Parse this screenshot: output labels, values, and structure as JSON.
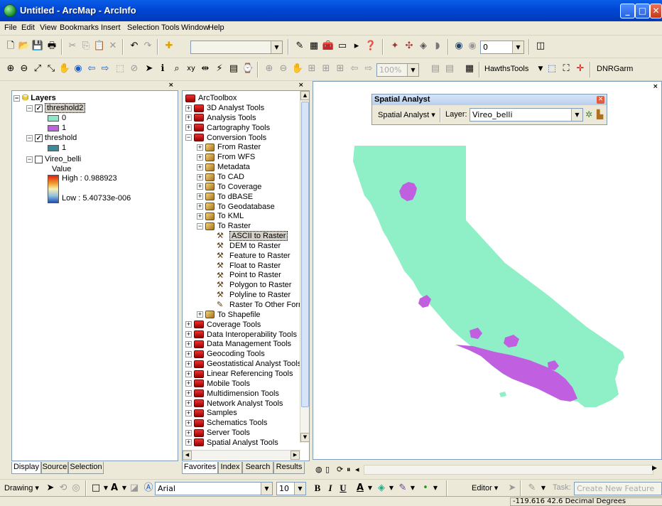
{
  "window": {
    "title": "Untitled - ArcMap - ArcInfo",
    "app_icon": "globe-icon",
    "minimize_glyph": "_",
    "maximize_glyph": "□",
    "close_glyph": "✕"
  },
  "menu": [
    "File",
    "Edit",
    "View",
    "Bookmarks",
    "Insert",
    "Selection",
    "Tools",
    "Window",
    "Help"
  ],
  "standard_toolbar": {
    "new": "🗋",
    "open": "📂",
    "save": "💾",
    "print": "🖶",
    "cut": "✂",
    "copy": "⎘",
    "paste": "📋",
    "delete": "✕",
    "undo": "↶",
    "redo": "↷",
    "add_data": "✚",
    "scale_value": "",
    "editor_toolbar_btn": "✎",
    "arc_catalog_btn": "▦",
    "toolbox_btn": "🧰",
    "cmd_line_btn": "▭",
    "python_btn": "▸",
    "whats_this": "❓",
    "effects_zoom": "0",
    "effects_btn": "◫"
  },
  "tools_toolbar": {
    "zoom_in": "⊕",
    "zoom_out": "⊖",
    "fixed_zoom_in": "⤢",
    "fixed_zoom_out": "⤡",
    "pan": "✋",
    "full_extent": "◉",
    "back": "⇦",
    "forward": "⇨",
    "select_features": "⬚",
    "clear_selection": "⊘",
    "select_elements": "➤",
    "identify": "ℹ",
    "find": "⌕",
    "go_to_xy": "xy",
    "measure": "⇹",
    "hyperlink": "⚡",
    "html_popup": "▤",
    "time_slider": "⌚",
    "zoom_pct": "100%",
    "hawths_label": "HawthsTools",
    "dnr_label": "DNRGarm"
  },
  "toc": {
    "root": "Layers",
    "layers": [
      {
        "name": "threshold2",
        "checked": true,
        "legend": [
          {
            "label": "0",
            "color": "#88E8C8"
          },
          {
            "label": "1",
            "color": "#C060E0"
          }
        ]
      },
      {
        "name": "threshold",
        "checked": true,
        "legend": [
          {
            "label": "1",
            "color": "#3A8A9A"
          }
        ]
      },
      {
        "name": "Vireo_belli",
        "checked": false,
        "value_label": "Value",
        "high": "High : 0.988923",
        "low": "Low : 5.40733e-006"
      }
    ],
    "tabs": [
      "Display",
      "Source",
      "Selection"
    ],
    "close": "×"
  },
  "toolbox": {
    "root": "ArcToolbox",
    "items": [
      {
        "label": "3D Analyst Tools",
        "level": 1,
        "kind": "toolbox",
        "exp": "+"
      },
      {
        "label": "Analysis Tools",
        "level": 1,
        "kind": "toolbox",
        "exp": "+"
      },
      {
        "label": "Cartography Tools",
        "level": 1,
        "kind": "toolbox",
        "exp": "+"
      },
      {
        "label": "Conversion Tools",
        "level": 1,
        "kind": "toolbox",
        "exp": "−"
      },
      {
        "label": "From Raster",
        "level": 2,
        "kind": "toolset",
        "exp": "+"
      },
      {
        "label": "From WFS",
        "level": 2,
        "kind": "toolset",
        "exp": "+"
      },
      {
        "label": "Metadata",
        "level": 2,
        "kind": "toolset",
        "exp": "+"
      },
      {
        "label": "To CAD",
        "level": 2,
        "kind": "toolset",
        "exp": "+"
      },
      {
        "label": "To Coverage",
        "level": 2,
        "kind": "toolset",
        "exp": "+"
      },
      {
        "label": "To dBASE",
        "level": 2,
        "kind": "toolset",
        "exp": "+"
      },
      {
        "label": "To Geodatabase",
        "level": 2,
        "kind": "toolset",
        "exp": "+"
      },
      {
        "label": "To KML",
        "level": 2,
        "kind": "toolset",
        "exp": "+"
      },
      {
        "label": "To Raster",
        "level": 2,
        "kind": "toolset",
        "exp": "−"
      },
      {
        "label": "ASCII to Raster",
        "level": 3,
        "kind": "tool",
        "exp": "",
        "selected": true
      },
      {
        "label": "DEM to Raster",
        "level": 3,
        "kind": "tool",
        "exp": ""
      },
      {
        "label": "Feature to Raster",
        "level": 3,
        "kind": "tool",
        "exp": ""
      },
      {
        "label": "Float to Raster",
        "level": 3,
        "kind": "tool",
        "exp": ""
      },
      {
        "label": "Point to Raster",
        "level": 3,
        "kind": "tool",
        "exp": ""
      },
      {
        "label": "Polygon to Raster",
        "level": 3,
        "kind": "tool",
        "exp": ""
      },
      {
        "label": "Polyline to Raster",
        "level": 3,
        "kind": "tool",
        "exp": ""
      },
      {
        "label": "Raster To Other Form",
        "level": 3,
        "kind": "script",
        "exp": ""
      },
      {
        "label": "To Shapefile",
        "level": 2,
        "kind": "toolset",
        "exp": "+"
      },
      {
        "label": "Coverage Tools",
        "level": 1,
        "kind": "toolbox",
        "exp": "+"
      },
      {
        "label": "Data Interoperability Tools",
        "level": 1,
        "kind": "toolbox",
        "exp": "+"
      },
      {
        "label": "Data Management Tools",
        "level": 1,
        "kind": "toolbox",
        "exp": "+"
      },
      {
        "label": "Geocoding Tools",
        "level": 1,
        "kind": "toolbox",
        "exp": "+"
      },
      {
        "label": "Geostatistical Analyst Tools",
        "level": 1,
        "kind": "toolbox",
        "exp": "+"
      },
      {
        "label": "Linear Referencing Tools",
        "level": 1,
        "kind": "toolbox",
        "exp": "+"
      },
      {
        "label": "Mobile Tools",
        "level": 1,
        "kind": "toolbox",
        "exp": "+"
      },
      {
        "label": "Multidimension Tools",
        "level": 1,
        "kind": "toolbox",
        "exp": "+"
      },
      {
        "label": "Network Analyst Tools",
        "level": 1,
        "kind": "toolbox",
        "exp": "+"
      },
      {
        "label": "Samples",
        "level": 1,
        "kind": "toolbox",
        "exp": "+"
      },
      {
        "label": "Schematics Tools",
        "level": 1,
        "kind": "toolbox",
        "exp": "+"
      },
      {
        "label": "Server Tools",
        "level": 1,
        "kind": "toolbox",
        "exp": "+"
      },
      {
        "label": "Spatial Analyst Tools",
        "level": 1,
        "kind": "toolbox",
        "exp": "+"
      }
    ],
    "tabs": [
      "Favorites",
      "Index",
      "Search",
      "Results"
    ],
    "close": "×"
  },
  "spatial_analyst": {
    "title": "Spatial Analyst",
    "menu_label": "Spatial Analyst ▾",
    "layer_label": "Layer:",
    "layer_value": "Vireo_belli",
    "close": "✕"
  },
  "map": {
    "land_color": "#8FF0C8",
    "habitat_color": "#C060E0",
    "close": "×",
    "view_buttons": [
      "◍",
      "▯",
      "⟳",
      "⏸",
      "◂"
    ]
  },
  "drawing_toolbar": {
    "drawing_label": "Drawing ▾",
    "font_name": "Arial",
    "font_size": "10",
    "bold": "B",
    "italic": "I",
    "underline": "U",
    "editor_label": "Editor ▾",
    "task_label": "Task:",
    "task_value": "Create New Feature"
  },
  "status": {
    "coordinates": "-119.616  42.6 Decimal Degrees"
  }
}
